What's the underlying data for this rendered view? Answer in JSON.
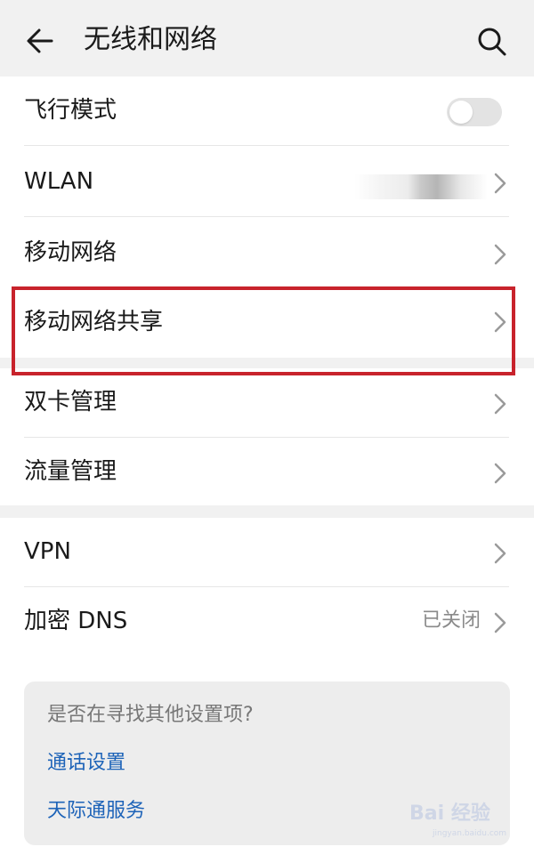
{
  "header": {
    "title": "无线和网络",
    "back_icon": "arrow-left-icon",
    "search_icon": "search-icon"
  },
  "group1": {
    "airplane": {
      "label": "飞行模式",
      "toggle_on": false
    },
    "wlan": {
      "label": "WLAN"
    },
    "mobile_network": {
      "label": "移动网络"
    },
    "hotspot": {
      "label": "移动网络共享"
    }
  },
  "group2": {
    "dual_sim": {
      "label": "双卡管理"
    },
    "data_usage": {
      "label": "流量管理"
    }
  },
  "group3": {
    "vpn": {
      "label": "VPN"
    },
    "private_dns": {
      "label": "加密 DNS",
      "value": "已关闭"
    }
  },
  "suggestions": {
    "question": "是否在寻找其他设置项?",
    "links": [
      "通话设置",
      "天际通服务"
    ]
  },
  "watermark": {
    "text": "Bai 经验",
    "sub": "jingyan.baidu.com"
  },
  "colors": {
    "highlight": "#c8232c",
    "link": "#1d63b8",
    "background": "#f1f1f1"
  }
}
